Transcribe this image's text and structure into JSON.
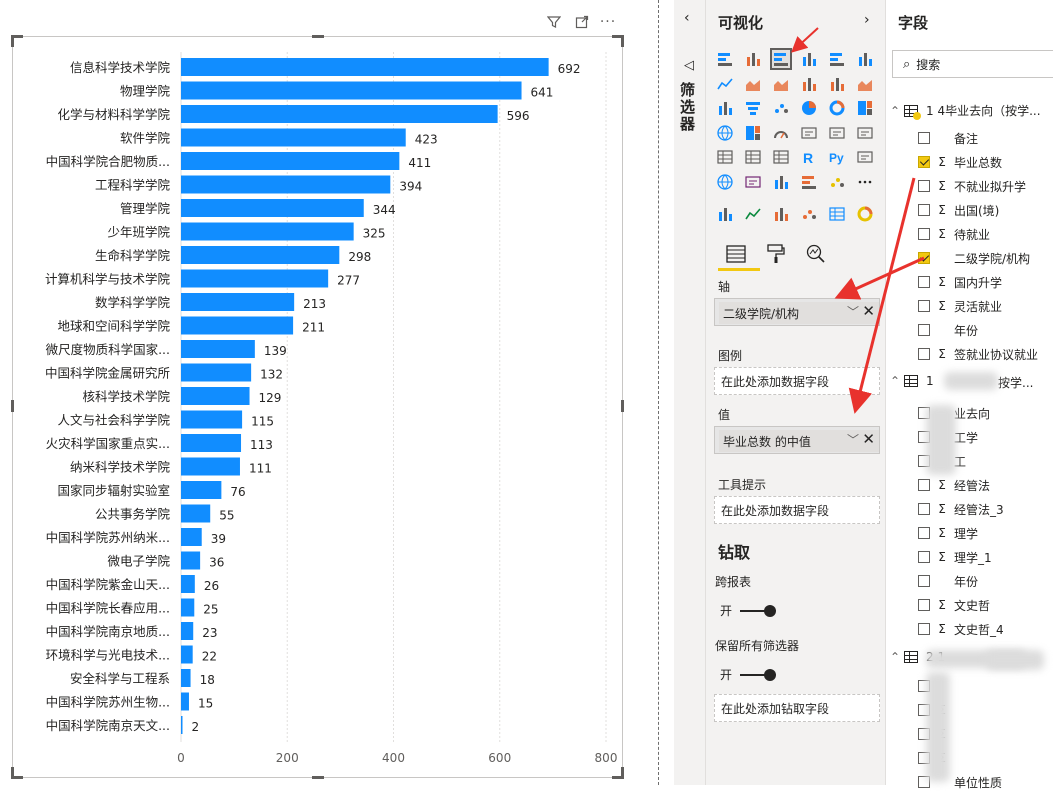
{
  "chart_data": {
    "type": "bar",
    "orientation": "horizontal",
    "categories": [
      "信息科学技术学院",
      "物理学院",
      "化学与材料科学学院",
      "软件学院",
      "中国科学院合肥物质...",
      "工程科学学院",
      "管理学院",
      "少年班学院",
      "生命科学学院",
      "计算机科学与技术学院",
      "数学科学学院",
      "地球和空间科学学院",
      "微尺度物质科学国家...",
      "中国科学院金属研究所",
      "核科学技术学院",
      "人文与社会科学学院",
      "火灾科学国家重点实...",
      "纳米科学技术学院",
      "国家同步辐射实验室",
      "公共事务学院",
      "中国科学院苏州纳米...",
      "微电子学院",
      "中国科学院紫金山天...",
      "中国科学院长春应用...",
      "中国科学院南京地质...",
      "环境科学与光电技术...",
      "安全科学与工程系",
      "中国科学院苏州生物...",
      "中国科学院南京天文..."
    ],
    "values": [
      692,
      641,
      596,
      423,
      411,
      394,
      344,
      325,
      298,
      277,
      213,
      211,
      139,
      132,
      129,
      115,
      113,
      111,
      76,
      55,
      39,
      36,
      26,
      25,
      23,
      22,
      18,
      15,
      2
    ],
    "xlim": [
      0,
      800
    ],
    "xticks": [
      "0",
      "200",
      "400",
      "600",
      "800"
    ],
    "grid": true,
    "bar_color": "#118dff"
  },
  "canvas": {
    "header_icons": [
      "filter-icon",
      "focus-mode-icon",
      "more-options-icon"
    ]
  },
  "filters": {
    "label": "筛选器"
  },
  "viz": {
    "title": "可视化",
    "sections": {
      "axis": "轴",
      "legend": "图例",
      "value": "值",
      "tooltip": "工具提示",
      "drill": "钻取",
      "cross_report": "跨报表",
      "keep_filters": "保留所有筛选器"
    },
    "axis_field": "二级学院/机构",
    "value_field": "毕业总数 的中值",
    "placeholder": "在此处添加数据字段",
    "drill_placeholder": "在此处添加钻取字段",
    "toggle_on": "开"
  },
  "fields": {
    "title": "字段",
    "search_placeholder": "搜索",
    "table1": "1 4毕业去向（按学...",
    "table1_fields": [
      {
        "name": "备注",
        "sigma": false,
        "checked": false
      },
      {
        "name": "毕业总数",
        "sigma": true,
        "checked": true
      },
      {
        "name": "不就业拟升学",
        "sigma": true,
        "checked": false
      },
      {
        "name": "出国(境)",
        "sigma": true,
        "checked": false
      },
      {
        "name": "待就业",
        "sigma": true,
        "checked": false
      },
      {
        "name": "二级学院/机构",
        "sigma": false,
        "checked": true
      },
      {
        "name": "国内升学",
        "sigma": true,
        "checked": false
      },
      {
        "name": "灵活就业",
        "sigma": true,
        "checked": false
      },
      {
        "name": "年份",
        "sigma": false,
        "checked": false
      },
      {
        "name": "签就业协议就业",
        "sigma": true,
        "checked": false
      }
    ],
    "table2_a": "1 ",
    "table2_b": "按学...",
    "table2_fields": [
      {
        "name": "业去向",
        "sigma": false,
        "checked": false
      },
      {
        "name": "工学",
        "sigma": false,
        "checked": false
      },
      {
        "name": "工",
        "sigma": true,
        "checked": false
      },
      {
        "name": "经管法",
        "sigma": true,
        "checked": false
      },
      {
        "name": "经管法_3",
        "sigma": true,
        "checked": false
      },
      {
        "name": "理学",
        "sigma": true,
        "checked": false
      },
      {
        "name": "理学_1",
        "sigma": true,
        "checked": false
      },
      {
        "name": "年份",
        "sigma": false,
        "checked": false
      },
      {
        "name": "文史哲",
        "sigma": true,
        "checked": false
      },
      {
        "name": "文史哲_4",
        "sigma": true,
        "checked": false
      }
    ],
    "table3": "2 1",
    "table3_fields": [
      {
        "name": "",
        "sigma": false,
        "checked": false
      },
      {
        "name": "",
        "sigma": true,
        "checked": false
      },
      {
        "name": "",
        "sigma": true,
        "checked": false
      },
      {
        "name": "",
        "sigma": true,
        "checked": false
      },
      {
        "name": "单位性质",
        "sigma": false,
        "checked": false
      }
    ]
  },
  "colors": {
    "accent": "#f2c811",
    "bar": "#118dff",
    "annotation": "#e8322d"
  }
}
